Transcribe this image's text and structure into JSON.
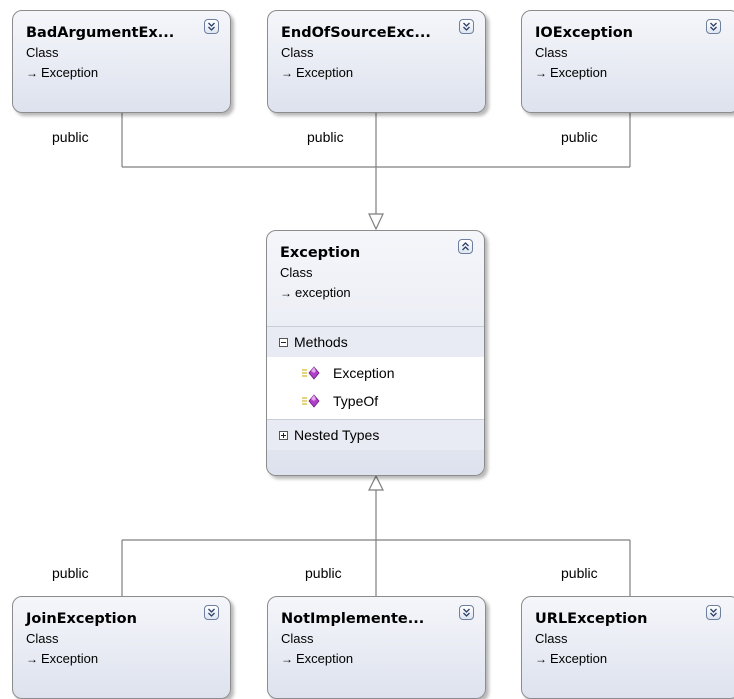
{
  "top_classes": [
    {
      "name": "BadArgumentEx...",
      "kind": "Class",
      "base": "Exception",
      "access": "public"
    },
    {
      "name": "EndOfSourceExc...",
      "kind": "Class",
      "base": "Exception",
      "access": "public"
    },
    {
      "name": "IOException",
      "kind": "Class",
      "base": "Exception",
      "access": "public"
    }
  ],
  "center_class": {
    "name": "Exception",
    "kind": "Class",
    "base": "exception",
    "methods_label": "Methods",
    "methods": [
      "Exception",
      "TypeOf"
    ],
    "nested_types_label": "Nested Types"
  },
  "bottom_classes": [
    {
      "name": "JoinException",
      "kind": "Class",
      "base": "Exception",
      "access": "public"
    },
    {
      "name": "NotImplemente...",
      "kind": "Class",
      "base": "Exception",
      "access": "public"
    },
    {
      "name": "URLException",
      "kind": "Class",
      "base": "Exception",
      "access": "public"
    }
  ],
  "icons": {
    "collapsed_toggle": "double-chevron-down-icon",
    "expanded_toggle": "double-chevron-up-icon",
    "inherits": "arrow-right-icon",
    "method": "method-icon"
  },
  "colors": {
    "card_top": "#f5f6fa",
    "card_bottom": "#dde2ee",
    "connector": "#7f7f7f",
    "method_icon": "#b040c8"
  }
}
